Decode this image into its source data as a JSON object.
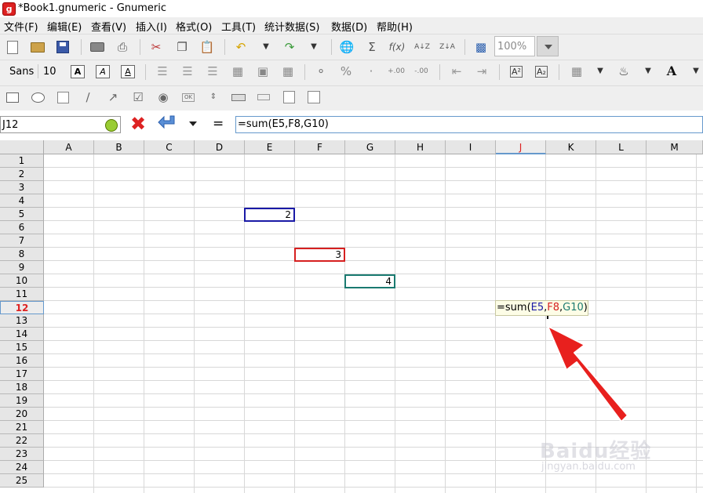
{
  "window": {
    "title": "*Book1.gnumeric - Gnumeric",
    "icon": "gnumeric-app-icon"
  },
  "menu": [
    "文件(F)",
    "编辑(E)",
    "查看(V)",
    "插入(I)",
    "格式(O)",
    "工具(T)",
    "统计数据(S)",
    "数据(D)",
    "帮助(H)"
  ],
  "toolbar": {
    "zoom_value": "100%"
  },
  "format_toolbar": {
    "font_name": "Sans",
    "font_size": "10",
    "bold_label": "A",
    "italic_label": "A",
    "underline_label": "A"
  },
  "name_box": {
    "value": "J12"
  },
  "formula_bar": {
    "equals": "=",
    "value": "=sum(E5,F8,G10)"
  },
  "columns": [
    "A",
    "B",
    "C",
    "D",
    "E",
    "F",
    "G",
    "H",
    "I",
    "J",
    "K",
    "L",
    "M"
  ],
  "rows": [
    "1",
    "2",
    "3",
    "4",
    "5",
    "6",
    "7",
    "8",
    "9",
    "10",
    "11",
    "12",
    "13",
    "14",
    "15",
    "16",
    "17",
    "18",
    "19",
    "20",
    "21",
    "22",
    "23",
    "24",
    "25"
  ],
  "active": {
    "column": "J",
    "row": "12"
  },
  "cells": {
    "E5": "2",
    "F8": "3",
    "G10": "4"
  },
  "editor": {
    "part1": "=sum(",
    "ref1": "E5",
    "comma1": ",",
    "ref2": "F8",
    "comma2": ",",
    "ref3": "G10",
    "close": ")"
  },
  "colors": {
    "ref_blue": "#1a1aa6",
    "ref_red": "#d62020",
    "ref_green": "#1a7a70",
    "annotation_arrow": "#e8201e"
  },
  "watermark": {
    "brand": "Baidu经验",
    "url": "jingyan.baidu.com"
  }
}
